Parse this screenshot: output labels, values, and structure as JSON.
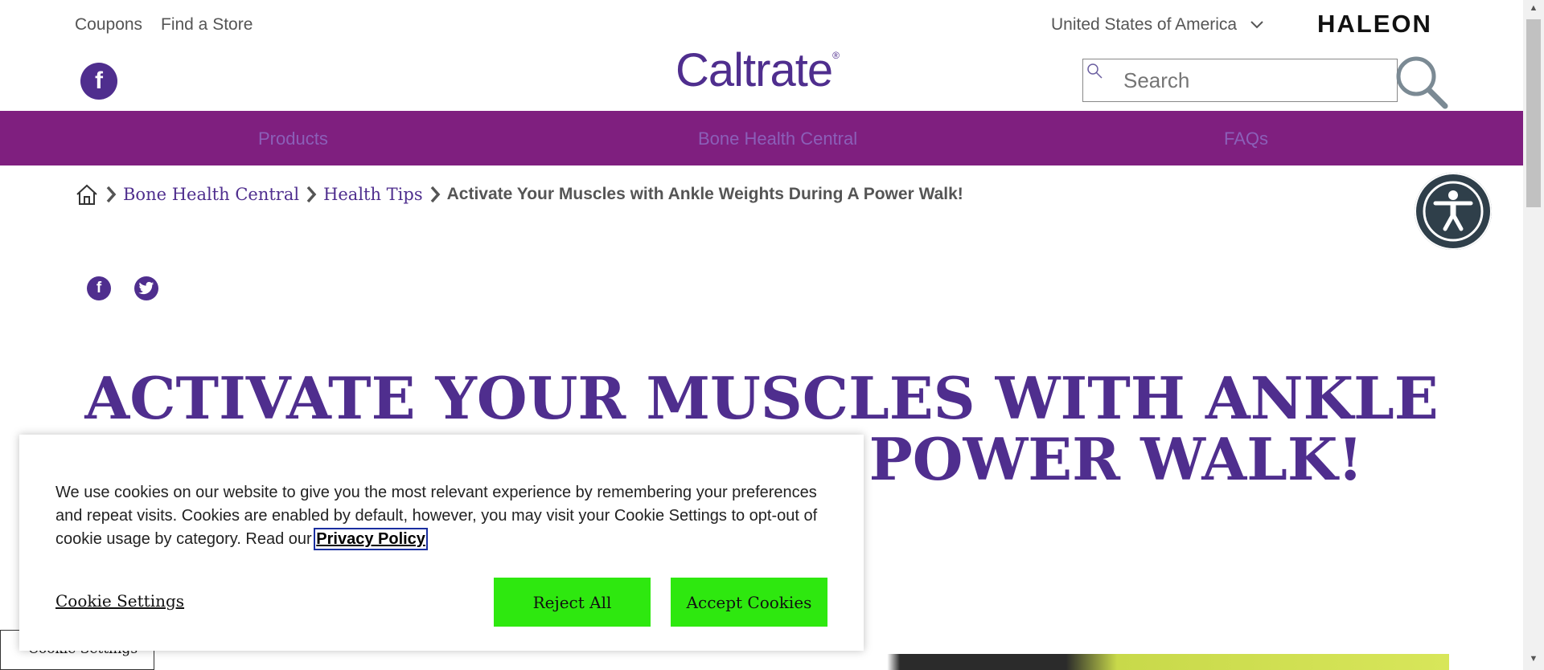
{
  "utility_nav": {
    "coupons": "Coupons",
    "find_store": "Find a Store"
  },
  "country_selector": {
    "label": "United States of America"
  },
  "corporate_logo": {
    "text": "HALEON"
  },
  "brand_logo": {
    "text": "Caltrate",
    "mark": "®"
  },
  "search": {
    "placeholder": "Search"
  },
  "main_nav": {
    "items": [
      "Products",
      "Bone Health Central",
      "FAQs"
    ]
  },
  "breadcrumb": {
    "items": [
      "Bone Health Central",
      "Health Tips"
    ],
    "current": "Activate Your Muscles with Ankle Weights During A Power Walk!"
  },
  "social_share": {
    "facebook": "f"
  },
  "article": {
    "headline_line1": "ACTIVATE YOUR MUSCLES WITH ANKLE",
    "headline_line2": "WEIGHTS DURING A POWER WALK!"
  },
  "cookie_banner": {
    "message": "We use cookies on our website to give you the most relevant experience by remembering your preferences and repeat visits. Cookies are enabled by default, however, you may visit your Cookie Settings to opt-out of cookie usage by category. Read our",
    "privacy_link": "Privacy Policy",
    "settings_link": "Cookie Settings",
    "reject_label": "Reject All",
    "accept_label": "Accept Cookies"
  },
  "cookie_settings_tab": {
    "label": "Cookie Settings"
  },
  "colors": {
    "brand_purple": "#4f2e8e",
    "nav_bar": "#7f1f7f",
    "nav_text": "#8b5fb8",
    "cookie_button": "#2ee80f",
    "accessibility_button": "#2f3f4a"
  }
}
